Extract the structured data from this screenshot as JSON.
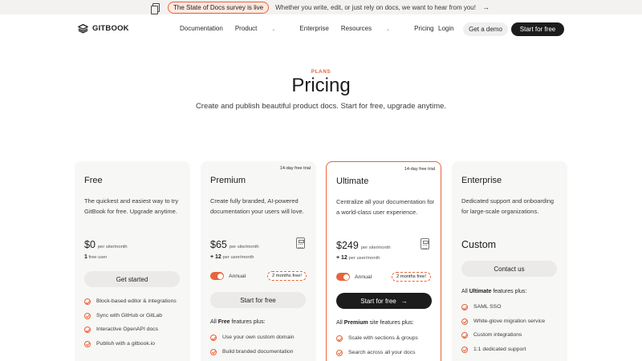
{
  "announcement": {
    "badge": "The State of Docs survey is live",
    "text": "Whether you write, edit, or just rely on docs, we want to hear from you!",
    "arrow": "→"
  },
  "nav": {
    "logo": "GITBOOK",
    "links": [
      "Documentation",
      "Product",
      "Enterprise",
      "Resources",
      "Pricing"
    ],
    "login": "Login",
    "demo": "Get a demo",
    "start": "Start for free"
  },
  "hero": {
    "eyebrow": "PLANS",
    "title": "Pricing",
    "subtitle": "Create and publish beautiful product docs. Start for free, upgrade anytime."
  },
  "plans": [
    {
      "name": "Free",
      "description": "The quickest and easiest way to try GitBook for free. Upgrade anytime.",
      "price": "$0",
      "price_unit": "per site/month",
      "sub_amount": "1",
      "sub_unit": "free user",
      "cta": "Get started",
      "features": [
        "Block-based editor & integrations",
        "Sync with GitHub or GitLab",
        "Interactive OpenAPI docs",
        "Publish with a gitbook.io"
      ]
    },
    {
      "name": "Premium",
      "trial": "14-day free trial",
      "description": "Create fully branded, AI-powered documentation your users will love.",
      "price": "$65",
      "price_unit": "per site/month",
      "sub_amount": "+ 12",
      "sub_unit": "per user/month",
      "toggle_label": "Annual",
      "badge": "2 months free!",
      "cta": "Start for free",
      "features_head_prefix": "All",
      "features_head_bold": "Free",
      "features_head_suffix": "features plus:",
      "features": [
        "Use your own custom domain",
        "Build branded documentation"
      ]
    },
    {
      "name": "Ultimate",
      "trial": "14-day free trial",
      "description": "Centralize all your documentation for a world-class user experience.",
      "price": "$249",
      "price_unit": "per site/month",
      "sub_amount": "+ 12",
      "sub_unit": "per user/month",
      "toggle_label": "Annual",
      "badge": "2 months free!",
      "cta": "Start for free",
      "cta_arrow": "→",
      "features_head_prefix": "All",
      "features_head_bold": "Premium",
      "features_head_suffix": "site features plus:",
      "features": [
        "Scale with sections & groups",
        "Search across all your docs"
      ]
    },
    {
      "name": "Enterprise",
      "description": "Dedicated support and onboarding for large-scale organizations.",
      "price": "Custom",
      "cta": "Contact us",
      "features_head_prefix": "All",
      "features_head_bold": "Ultimate",
      "features_head_suffix": "features plus:",
      "features": [
        "SAML SSO",
        "White-glove migration service",
        "Custom integrations",
        "1:1 dedicated support"
      ]
    }
  ],
  "colors": {
    "accent": "#e8643c",
    "dark": "#1c1c1c",
    "card_bg": "#f7f7f6"
  }
}
